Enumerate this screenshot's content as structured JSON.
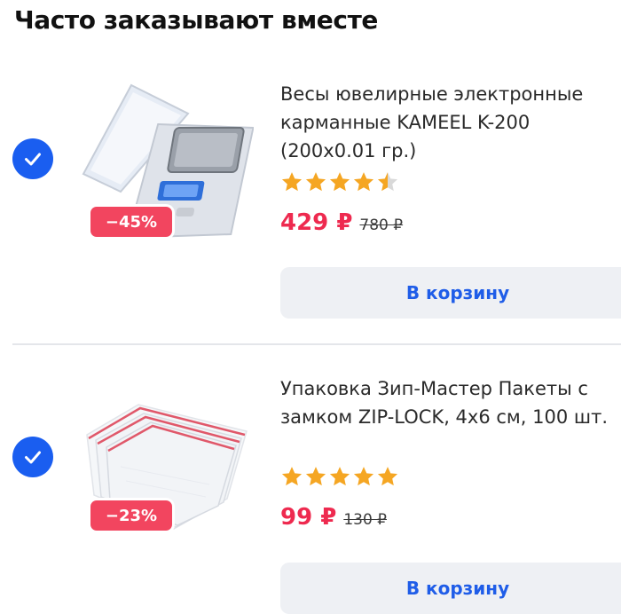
{
  "title": "Часто заказывают вместе",
  "colors": {
    "accent": "#1a5ef0",
    "price": "#ee2a4f",
    "discount_bg": "#f2455f",
    "star": "#f5a623",
    "button_bg": "#eef0f4",
    "button_text": "#1f5de8"
  },
  "products": [
    {
      "selected": true,
      "image": "pocket-scale-image",
      "discount": "−45%",
      "name": "Весы ювелирные электронные карманные KAMEEL K-200 (200x0.01 гр.)",
      "rating": 4.5,
      "price": "429 ₽",
      "old_price": "780 ₽",
      "button_label": "В корзину"
    },
    {
      "selected": true,
      "image": "zip-lock-bags-image",
      "discount": "−23%",
      "name": "Упаковка Зип-Мастер Пакеты с замком ZIP-LOCK, 4x6 см, 100 шт.",
      "rating": 5,
      "price": "99 ₽",
      "old_price": "130 ₽",
      "button_label": "В корзину"
    }
  ]
}
